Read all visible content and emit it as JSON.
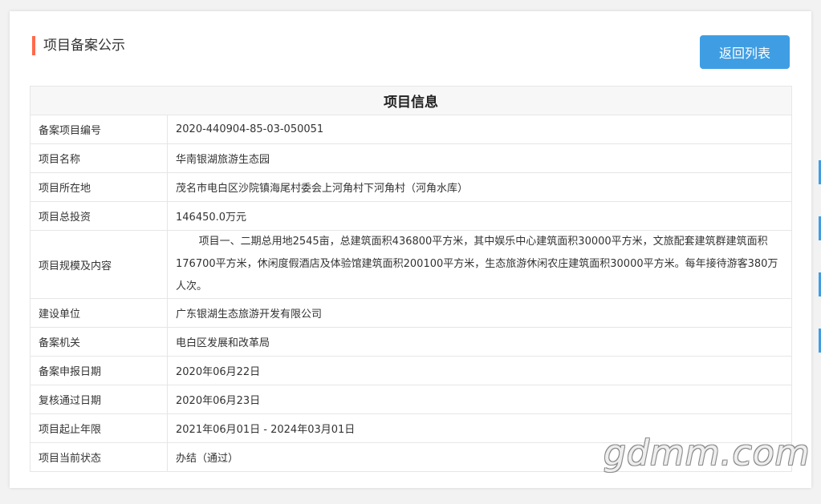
{
  "page": {
    "heading": "项目备案公示",
    "back_button": "返回列表"
  },
  "table": {
    "title": "项目信息",
    "rows": [
      {
        "label": "备案项目编号",
        "value": "2020-440904-85-03-050051"
      },
      {
        "label": "项目名称",
        "value": "华南银湖旅游生态园"
      },
      {
        "label": "项目所在地",
        "value": "茂名市电白区沙院镇海尾村委会上河角村下河角村（河角水库）"
      },
      {
        "label": "项目总投资",
        "value": "146450.0万元"
      },
      {
        "label": "项目规模及内容",
        "value": "项目一、二期总用地2545亩，总建筑面积436800平方米，其中娱乐中心建筑面积30000平方米，文旅配套建筑群建筑面积176700平方米，休闲度假酒店及体验馆建筑面积200100平方米，生态旅游休闲农庄建筑面积30000平方米。每年接待游客380万人次。"
      },
      {
        "label": "建设单位",
        "value": "广东银湖生态旅游开发有限公司"
      },
      {
        "label": "备案机关",
        "value": "电白区发展和改革局"
      },
      {
        "label": "备案申报日期",
        "value": "2020年06月22日"
      },
      {
        "label": "复核通过日期",
        "value": "2020年06月23日"
      },
      {
        "label": "项目起止年限",
        "value": "2021年06月01日 - 2024年03月01日"
      },
      {
        "label": "项目当前状态",
        "value": "办结（通过）"
      }
    ]
  },
  "watermark": "gdmm.com",
  "colors": {
    "accent_bar": "#ff6a4d",
    "button": "#3f9ee3"
  }
}
